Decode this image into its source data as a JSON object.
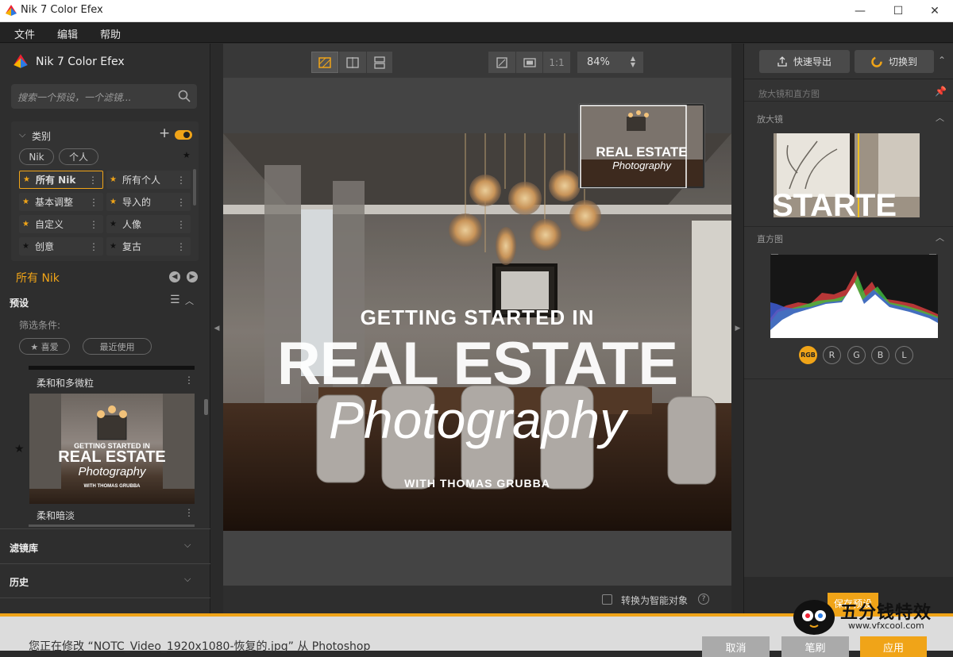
{
  "window": {
    "title": "Nik 7 Color Efex",
    "minimize": "—",
    "maximize": "☐",
    "close": "✕"
  },
  "menu": [
    "文件",
    "编辑",
    "帮助"
  ],
  "left": {
    "app_name": "Nik 7 Color Efex",
    "search_placeholder": "搜索一个预设，一个滤镜...",
    "category_label": "类别",
    "add": "+",
    "tags": [
      "Nik",
      "个人"
    ],
    "categories": [
      {
        "label": "所有 Nik",
        "star": "gold"
      },
      {
        "label": "所有个人",
        "star": "gold"
      },
      {
        "label": "基本调整",
        "star": "gold"
      },
      {
        "label": "导入的",
        "star": "gold"
      },
      {
        "label": "自定义",
        "star": "gold"
      },
      {
        "label": "人像",
        "star": "dark"
      },
      {
        "label": "创意",
        "star": "dark"
      },
      {
        "label": "复古",
        "star": "dark"
      }
    ],
    "current_category": "所有 Nik",
    "presets_label": "预设",
    "filter_label": "筛选条件:",
    "filter_buttons": [
      "★ 喜爱",
      "最近使用"
    ],
    "preset_items": [
      "柔和和多微粒",
      "柔和暗淡"
    ],
    "library_label": "滤镜库",
    "history_label": "历史"
  },
  "toolbar": {
    "one_to_one": "1:1",
    "zoom": "84%"
  },
  "image": {
    "line1": "GETTING STARTED IN",
    "line2": "REAL ESTATE",
    "line3": "Photography",
    "line4": "WITH THOMAS GRUBBA"
  },
  "center": {
    "smart_object": "转换为智能对象",
    "help": "?"
  },
  "right": {
    "quick_export": "快速导出",
    "switch_to": "切换到",
    "panel_title": "放大镜和直方图",
    "loupe_label": "放大镜",
    "loupe_text": "STARTE",
    "histogram_label": "直方图",
    "channels": [
      "RGB",
      "R",
      "G",
      "B",
      "L"
    ],
    "save_preset": "保存预设"
  },
  "bottom": {
    "status": "您正在修改 “NOTC_Video_1920x1080-恢复的.jpg” 从 Photoshop",
    "cancel": "取消",
    "brush": "笔刷",
    "apply": "应用"
  },
  "watermark": {
    "name": "五分钱特效",
    "url": "www.vfxcool.com"
  },
  "colors": {
    "accent": "#f0a418",
    "panel": "#2e2e2e"
  }
}
